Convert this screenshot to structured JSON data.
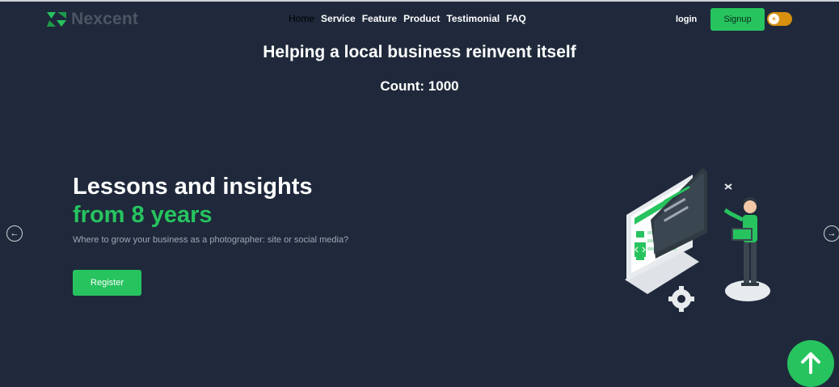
{
  "header": {
    "brand": "Nexcent",
    "nav": [
      {
        "label": "Home",
        "active": true
      },
      {
        "label": "Service"
      },
      {
        "label": "Feature"
      },
      {
        "label": "Product"
      },
      {
        "label": "Testimonial"
      },
      {
        "label": "FAQ"
      }
    ],
    "login_label": "login",
    "signup_label": "Signup",
    "theme_toggle_icon": "sun-icon"
  },
  "main": {
    "headline": "Helping a local business reinvent itself",
    "count_text": "Count: 1000"
  },
  "hero": {
    "title_line1": "Lessons and insights",
    "title_line2": "from 8 years",
    "subtitle": "Where to grow your business as a photographer: site or social media?",
    "register_label": "Register",
    "illustration": "developer-with-laptop-illustration"
  },
  "carousel": {
    "prev_icon": "arrow-left-icon",
    "next_icon": "arrow-right-icon"
  },
  "scroll_top_icon": "arrow-up-icon",
  "colors": {
    "background": "#1f293b",
    "accent": "#27c35f",
    "toggle": "#d8900f"
  }
}
